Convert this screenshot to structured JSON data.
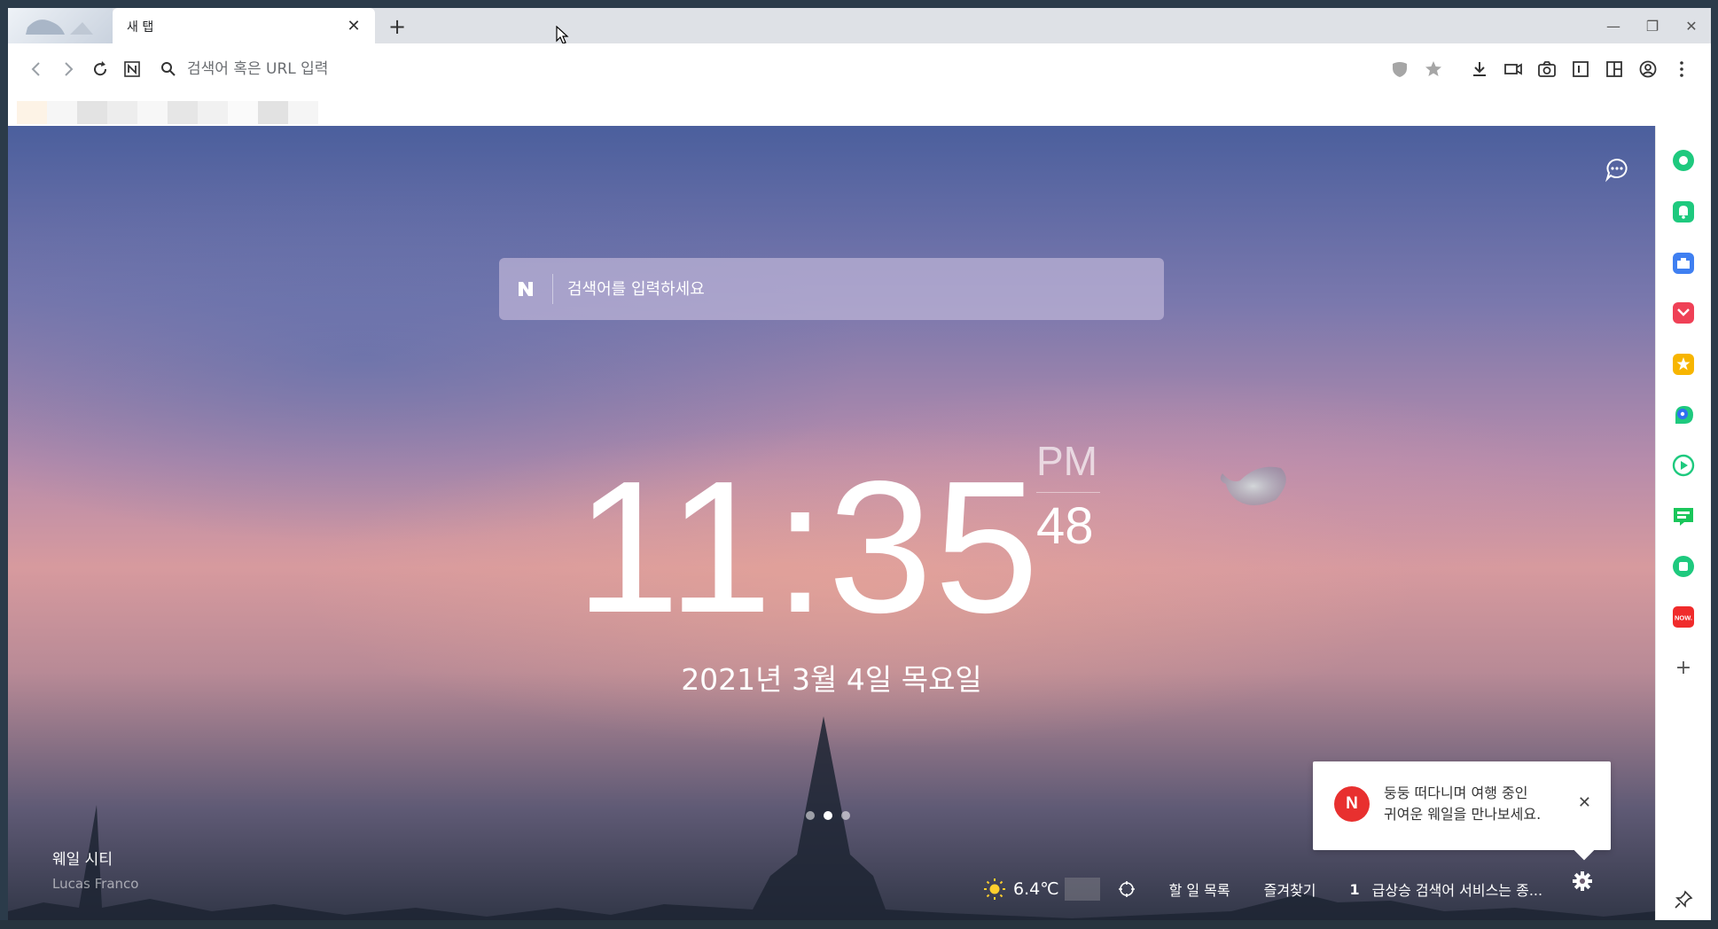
{
  "tab": {
    "title": "새 탭",
    "close_glyph": "✕",
    "new_glyph": "+"
  },
  "window_controls": {
    "minimize": "—",
    "restore": "❐",
    "close": "✕"
  },
  "toolbar": {
    "address_placeholder": "검색어 혹은 URL 입력",
    "icons": [
      "back-icon",
      "forward-icon",
      "reload-icon",
      "naver-home-icon",
      "search-icon",
      "shield-icon",
      "star-icon",
      "download-icon",
      "video-icon",
      "camera-icon",
      "reader-icon",
      "split-view-icon",
      "profile-icon",
      "menu-icon"
    ]
  },
  "search": {
    "placeholder": "검색어를 입력하세요",
    "logo_letter": "N"
  },
  "clock": {
    "hours": "11",
    "minutes": "35",
    "ampm": "PM",
    "seconds": "48"
  },
  "date": "2021년 3월 4일 목요일",
  "credit": {
    "title": "웨일 시티",
    "author": "Lucas Franco"
  },
  "widgets": {
    "temperature": "6.4℃",
    "todo": "할 일 목록",
    "favorites": "즐겨찾기",
    "trend_rank": "1",
    "trend_text": "급상승 검색어 서비스는 종..."
  },
  "toast": {
    "logo_letter": "N",
    "line1": "둥둥 떠다니며 여행 중인",
    "line2": "귀여운 웨일을 만나보세요.",
    "close_glyph": "✕"
  },
  "sidebar": {
    "items": [
      {
        "name": "green-circle-icon",
        "color": "#1ec97e"
      },
      {
        "name": "bell-icon",
        "color": "#1ec97e"
      },
      {
        "name": "toolbox-icon",
        "color": "#3f7ff1"
      },
      {
        "name": "pocket-icon",
        "color": "#ef4056"
      },
      {
        "name": "favorite-star-icon",
        "color": "#f7b500"
      },
      {
        "name": "papago-icon",
        "color": "#1ec97e"
      },
      {
        "name": "music-icon",
        "color": "#1ec97e"
      },
      {
        "name": "webtoon-icon",
        "color": "#19c65a"
      },
      {
        "name": "green-square-icon",
        "color": "#1ec97e"
      },
      {
        "name": "now-icon",
        "color": "#f02b2b"
      },
      {
        "name": "add-icon",
        "color": "#555555"
      }
    ],
    "add_glyph": "+",
    "now_label": "NOW."
  },
  "colors": {
    "accent_green": "#1ec97e",
    "naver_red": "#e8302f"
  }
}
